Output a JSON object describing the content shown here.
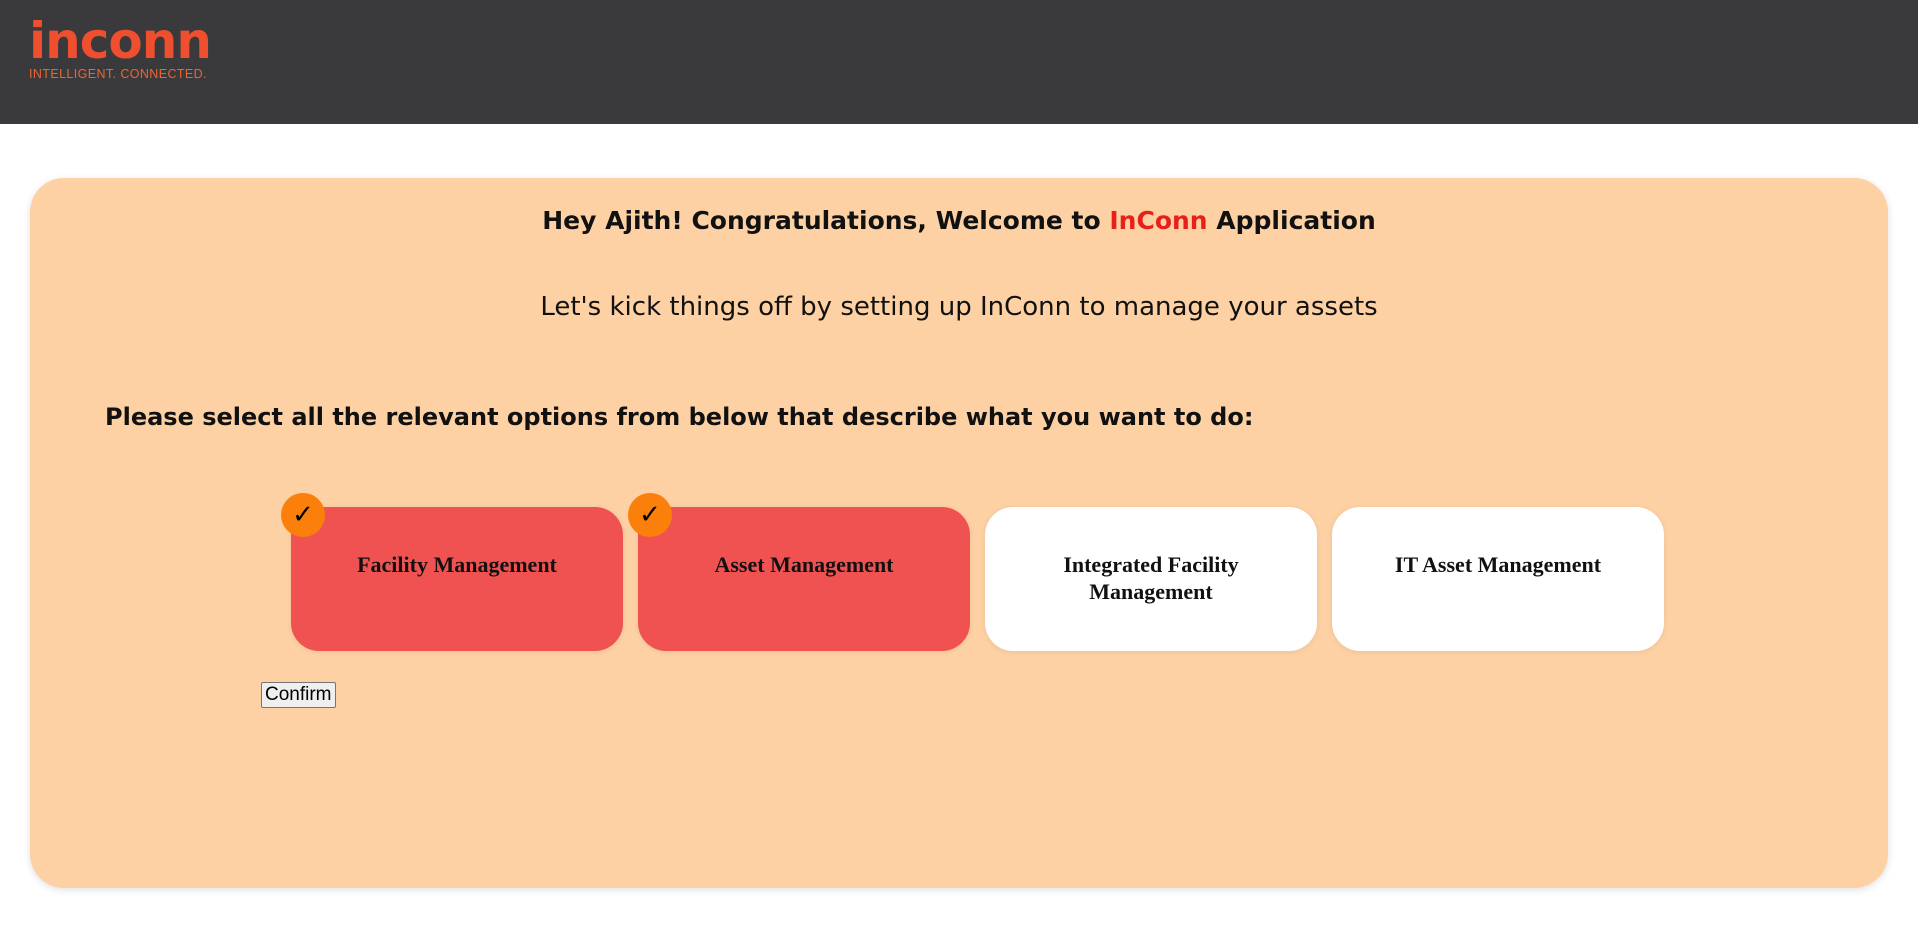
{
  "header": {
    "logo": {
      "word": "inconn",
      "tagline": "INTELLIGENT. CONNECTED."
    }
  },
  "welcome": {
    "prefix": "Hey Ajith! Congratulations, Welcome to ",
    "brand": "InConn",
    "suffix": " Application"
  },
  "subtitle": "Let's kick things off by setting up InConn to manage your assets",
  "prompt": "Please select all the relevant options from below that describe what you want to do:",
  "options": [
    {
      "label": "Facility Management",
      "selected": true
    },
    {
      "label": "Asset Management",
      "selected": true
    },
    {
      "label": "Integrated Facility Management",
      "selected": false
    },
    {
      "label": "IT Asset Management",
      "selected": false
    }
  ],
  "check_glyph": "✓",
  "confirm_label": "Confirm",
  "colors": {
    "header_bg": "#3a3a3c",
    "card_bg": "#fdd1a3",
    "selected_option_bg": "#ef5251",
    "check_badge": "#fb7f0b",
    "brand_red": "#e8201a"
  }
}
